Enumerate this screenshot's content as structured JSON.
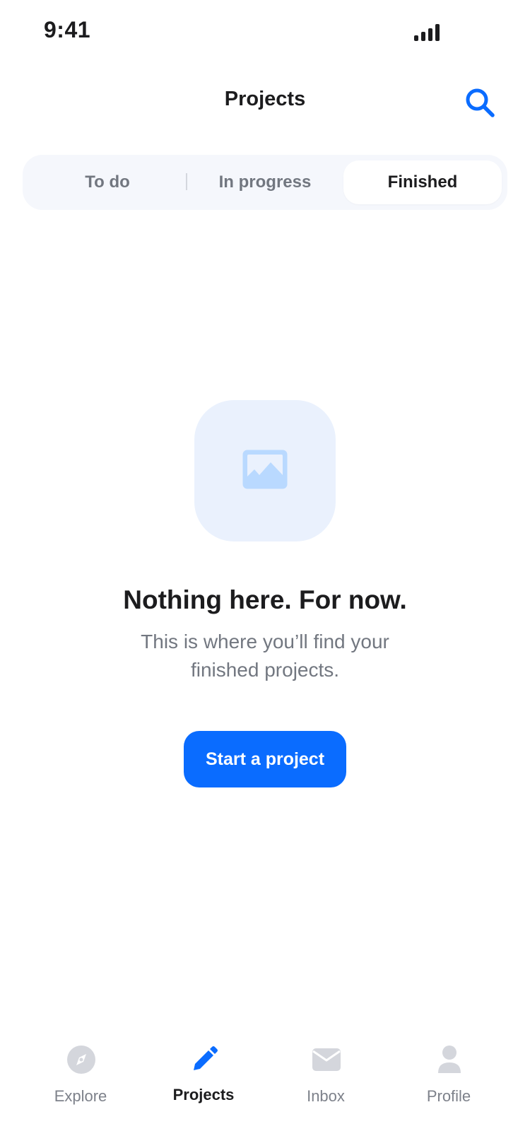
{
  "status_bar": {
    "time": "9:41",
    "signal_icon": "cellular-signal-icon"
  },
  "header": {
    "title": "Projects",
    "search_icon": "search-icon",
    "accent_color": "#0a6cff"
  },
  "segmented_control": {
    "selected": "Finished",
    "segments": [
      {
        "label": "To do"
      },
      {
        "label": "In progress"
      },
      {
        "label": "Finished"
      }
    ]
  },
  "empty_state": {
    "icon": "image-placeholder-icon",
    "title": "Nothing here. For now.",
    "subtitle": "This is where you’ll find your finished projects.",
    "button_label": "Start a project",
    "button_color": "#0a6cff"
  },
  "tab_bar": {
    "active": "Projects",
    "tabs": [
      {
        "label": "Explore",
        "icon": "compass-icon"
      },
      {
        "label": "Projects",
        "icon": "pencil-icon"
      },
      {
        "label": "Inbox",
        "icon": "envelope-icon"
      },
      {
        "label": "Profile",
        "icon": "person-icon"
      }
    ]
  }
}
